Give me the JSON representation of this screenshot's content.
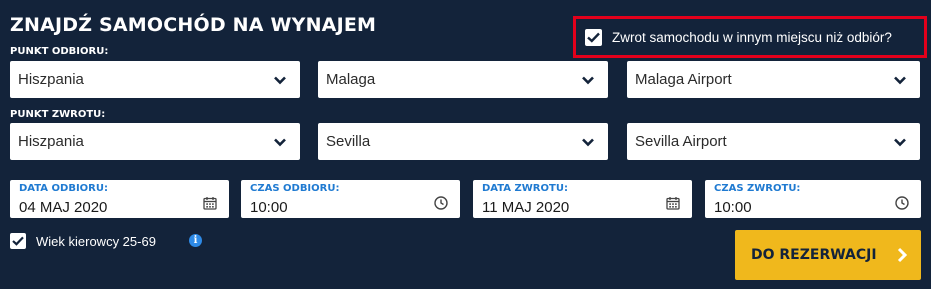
{
  "form": {
    "title": "ZNAJDŹ SAMOCHÓD NA WYNAJEM",
    "different_return_label": "Zwrot samochodu w innym miejscu niż odbiór?",
    "different_return_checked": true
  },
  "pickup": {
    "section_label": "PUNKT ODBIORU:",
    "country": "Hiszpania",
    "city": "Malaga",
    "location": "Malaga Airport"
  },
  "return": {
    "section_label": "PUNKT ZWROTU:",
    "country": "Hiszpania",
    "city": "Sevilla",
    "location": "Sevilla Airport"
  },
  "dates": {
    "pickup_date_label": "DATA ODBIORU:",
    "pickup_date": "04 MAJ 2020",
    "pickup_time_label": "CZAS ODBIORU:",
    "pickup_time": "10:00",
    "return_date_label": "DATA ZWROTU:",
    "return_date": "11 MAJ 2020",
    "return_time_label": "CZAS ZWROTU:",
    "return_time": "10:00"
  },
  "driver": {
    "age_label": "Wiek kierowcy 25-69",
    "age_checked": true,
    "info_icon": "i"
  },
  "cta": {
    "label": "DO REZERWACJI"
  },
  "colors": {
    "background": "#13233a",
    "highlight_border": "#e3001b",
    "field_label": "#1f7ad1",
    "cta": "#f0b81c"
  }
}
